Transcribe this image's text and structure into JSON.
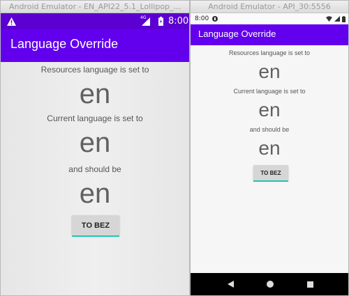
{
  "left_emulator": {
    "window_title": "Android Emulator - EN_API22_5.1_Lollipop_...",
    "status_time": "8:00",
    "network_label": "4G",
    "app_title": "Language Override",
    "resources_label": "Resources language is set to",
    "resources_value": "en",
    "current_label": "Current language is set to",
    "current_value": "en",
    "should_label": "and should be",
    "should_value": "en",
    "button_label": "TO BEZ"
  },
  "right_emulator": {
    "window_title": "Android Emulator - API_30:5556",
    "status_time": "8:00",
    "app_title": "Language Override",
    "resources_label": "Resources language is set to",
    "resources_value": "en",
    "current_label": "Current language is set to",
    "current_value": "en",
    "should_label": "and should be",
    "should_value": "en",
    "button_label": "TO BEZ"
  },
  "colors": {
    "app_bar": "#6200ee",
    "status_bar": "#5c00d2",
    "button_underline": "#1fc6b6",
    "nav_bar": "#000000"
  }
}
